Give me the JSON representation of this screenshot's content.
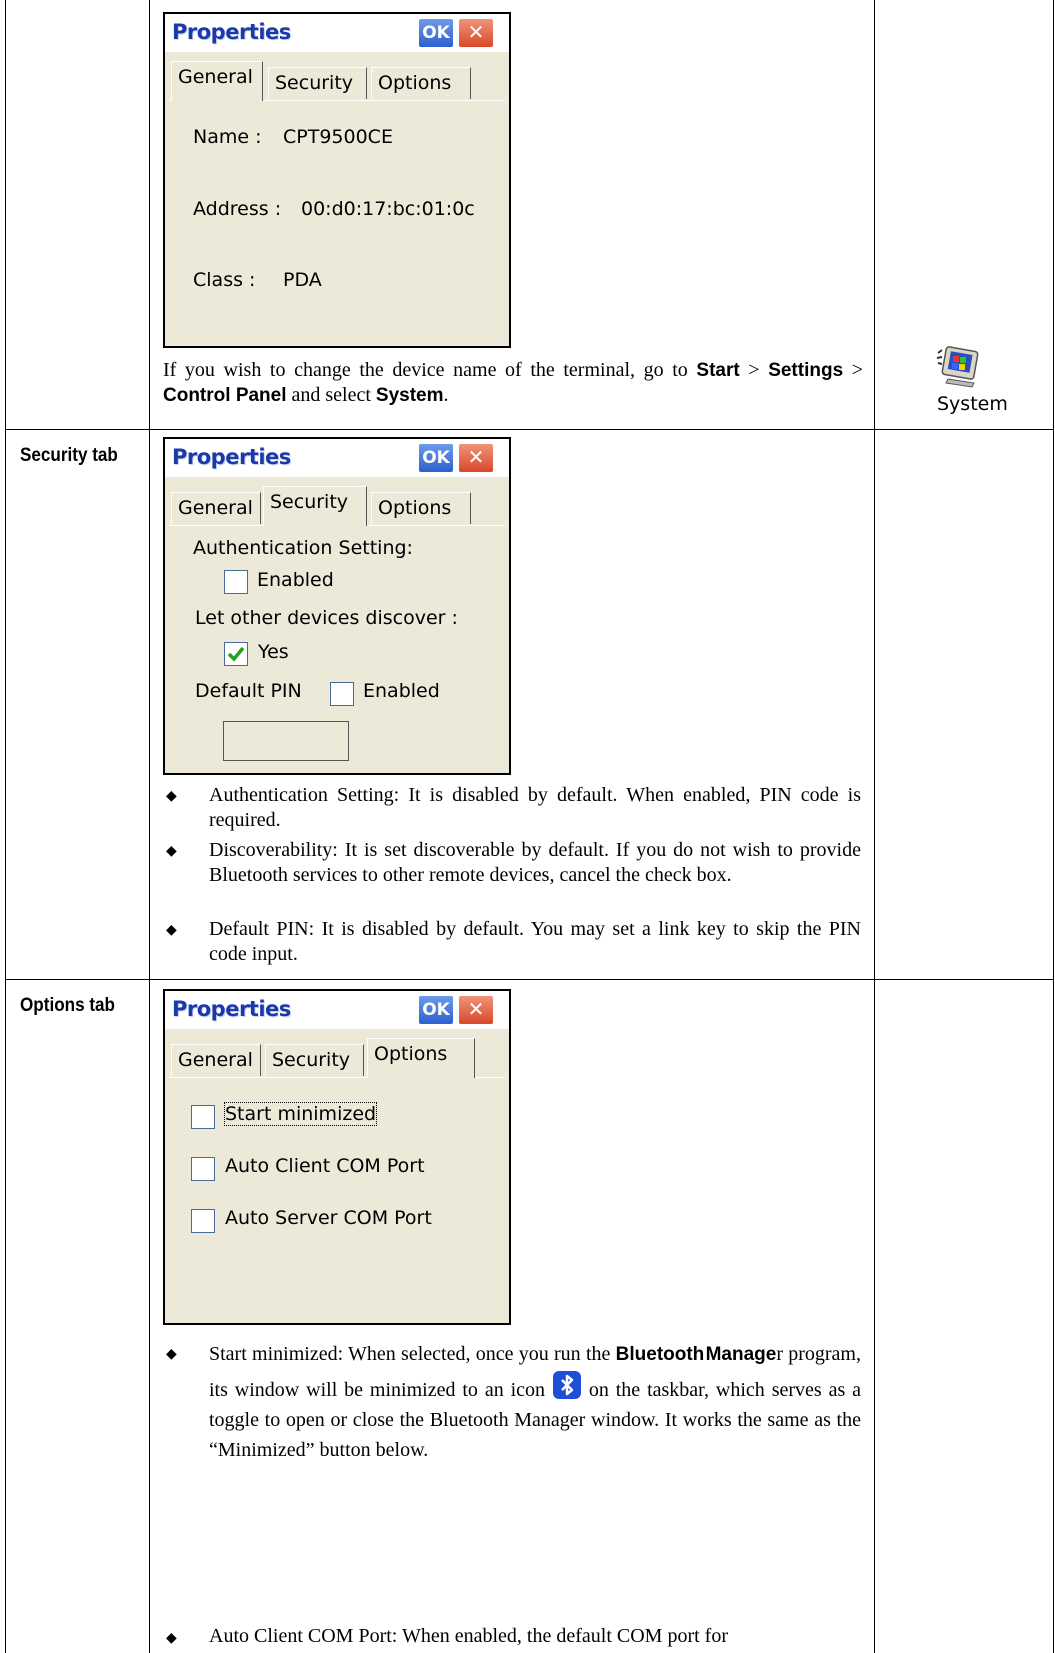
{
  "dialog": {
    "title": "Properties",
    "ok_label": "OK",
    "close_glyph": "✕",
    "tabs": [
      "General",
      "Security",
      "Options"
    ]
  },
  "general": {
    "name_label": "Name :",
    "name_value": "CPT9500CE",
    "address_label": "Address :",
    "address_value": "00:d0:17:bc:01:0c",
    "class_label": "Class :",
    "class_value": "PDA",
    "note_pre": "If you wish to change the device name of the terminal, go to",
    "note_start": "Start",
    "note_settings": "Settings",
    "note_cp": "Control Panel",
    "note_mid": "and select",
    "note_system": "System",
    "system_icon_label": "System"
  },
  "security": {
    "row_label": "Security tab",
    "auth_heading": "Authentication Setting:",
    "auth_checkbox": "Enabled",
    "auth_checked": false,
    "discover_heading": "Let other devices discover :",
    "discover_checkbox": "Yes",
    "discover_checked": true,
    "pin_label": "Default PIN",
    "pin_checkbox": "Enabled",
    "pin_checked": false,
    "pin_value": "",
    "bullets": [
      "Authentication Setting: It is disabled by default. When enabled, PIN code is required.",
      "Discoverability: It is set discoverable by default. If you do not wish to provide Bluetooth services to other remote devices, cancel the check box.",
      "Default PIN: It is disabled by default. You may set a link key to skip the PIN code input."
    ]
  },
  "options": {
    "row_label": "Options tab",
    "checkboxes": [
      "Start minimized",
      "Auto Client COM Port",
      "Auto Server COM Port"
    ],
    "checked": [
      false,
      false,
      false
    ],
    "bullet1_pre": "Start minimized: When selected, once you run the",
    "bullet1_bold1": "Bluetooth",
    "bullet1_bold2": "Manage",
    "bullet1_mid": "r program, its window will be minimized to an icon",
    "bullet1_post": "on the taskbar, which serves as a toggle to open or close the Bluetooth Manager window. It works the same as the “Minimized” button below.",
    "bullet2": "Auto Client COM Port: When enabled, the default COM port for"
  },
  "colors": {
    "dialog_bg": "#ece9d8",
    "title_text": "#1b3aa8",
    "ok_button": "#2d5fd0",
    "close_button": "#d9482a",
    "check_mark": "#21a121"
  }
}
